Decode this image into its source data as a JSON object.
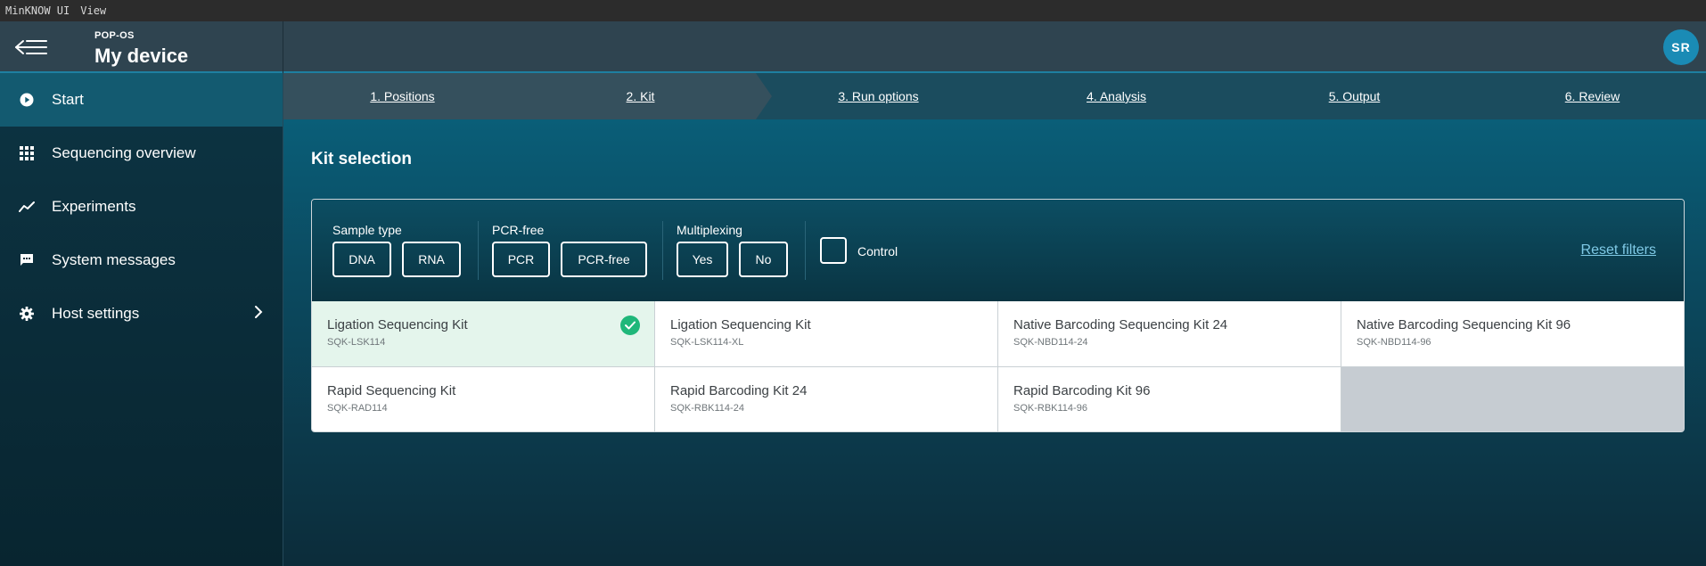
{
  "menubar": {
    "app": "MinKNOW UI",
    "view": "View"
  },
  "header": {
    "subtitle": "POP-OS",
    "title": "My device",
    "avatar_initials": "SR"
  },
  "sidebar": {
    "items": [
      {
        "label": "Start",
        "icon": "play-circle-icon",
        "active": true
      },
      {
        "label": "Sequencing overview",
        "icon": "grid-icon"
      },
      {
        "label": "Experiments",
        "icon": "trend-line-icon"
      },
      {
        "label": "System messages",
        "icon": "chat-bubble-icon"
      },
      {
        "label": "Host settings",
        "icon": "gear-icon",
        "has_chevron": true
      }
    ]
  },
  "stepper": {
    "steps": [
      {
        "label": "1. Positions",
        "state": "complete"
      },
      {
        "label": "2. Kit",
        "state": "current"
      },
      {
        "label": "3. Run options",
        "state": "upcoming"
      },
      {
        "label": "4. Analysis",
        "state": "upcoming"
      },
      {
        "label": "5. Output",
        "state": "upcoming"
      },
      {
        "label": "6. Review",
        "state": "upcoming"
      }
    ]
  },
  "main": {
    "title": "Kit selection",
    "filters": {
      "sample_type": {
        "label": "Sample type",
        "options": [
          "DNA",
          "RNA"
        ]
      },
      "pcr": {
        "label": "PCR-free",
        "options": [
          "PCR",
          "PCR-free"
        ]
      },
      "multiplexing": {
        "label": "Multiplexing",
        "options": [
          "Yes",
          "No"
        ]
      },
      "control": {
        "label": "Control",
        "checked": false
      },
      "reset_label": "Reset filters"
    },
    "kits": [
      {
        "name": "Ligation Sequencing Kit",
        "code": "SQK-LSK114",
        "selected": true
      },
      {
        "name": "Ligation Sequencing Kit",
        "code": "SQK-LSK114-XL"
      },
      {
        "name": "Native Barcoding Sequencing Kit 24",
        "code": "SQK-NBD114-24"
      },
      {
        "name": "Native Barcoding Sequencing Kit 96",
        "code": "SQK-NBD114-96"
      },
      {
        "name": "Rapid Sequencing Kit",
        "code": "SQK-RAD114"
      },
      {
        "name": "Rapid Barcoding Kit 24",
        "code": "SQK-RBK114-24"
      },
      {
        "name": "Rapid Barcoding Kit 96",
        "code": "SQK-RBK114-96"
      }
    ]
  },
  "colors": {
    "accent": "#1a8bb5",
    "selected_bg": "#e4f5ec",
    "check": "#1fb77a",
    "link": "#7fc9e6"
  }
}
